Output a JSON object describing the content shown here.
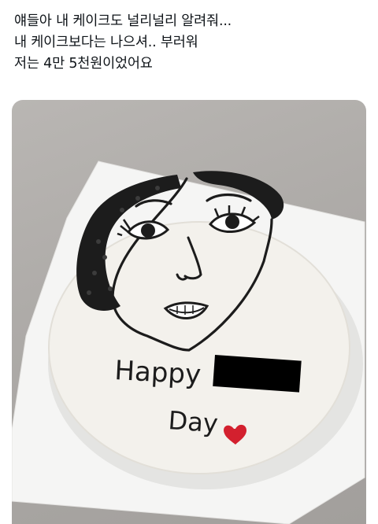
{
  "post": {
    "lines": [
      "얘들아 내 케이크도 널리널리 알려줘...",
      "내 케이크보다는 나으셔.. 부러워",
      "저는 4만 5천원이었어요"
    ]
  },
  "media": {
    "cake_text_line1": "Happy",
    "cake_text_line2": "Day",
    "colors": {
      "icing": "#f3f1ec",
      "board": "#f6f6f6",
      "piping": "#1c1c1c",
      "heart": "#d3202e",
      "redaction": "#000000",
      "background": "#aeaba8"
    }
  }
}
